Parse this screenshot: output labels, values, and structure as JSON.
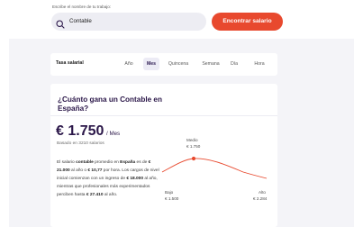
{
  "search": {
    "label": "Escribe el nombre de tu trabajo:",
    "value": "Contable",
    "button_label": "Encontrar salario"
  },
  "tabs": {
    "title": "Tasa salarial",
    "items": [
      {
        "label": "Año",
        "active": false
      },
      {
        "label": "Mes",
        "active": true
      },
      {
        "label": "Quincena",
        "active": false
      },
      {
        "label": "Semana",
        "active": false
      },
      {
        "label": "Día",
        "active": false
      },
      {
        "label": "Hora",
        "active": false
      }
    ]
  },
  "summary": {
    "question": "¿Cuánto gana un Contable en España?",
    "amount": "€ 1.750",
    "period": "/ Mes",
    "based_on": "Basado en 3210 salarios",
    "description": [
      {
        "text": "El salario ",
        "bold": false
      },
      {
        "text": "contable",
        "bold": true
      },
      {
        "text": " promedio en ",
        "bold": false
      },
      {
        "text": "España",
        "bold": true
      },
      {
        "text": " es de ",
        "bold": false
      },
      {
        "text": "€ 21.000",
        "bold": true
      },
      {
        "text": " al año o ",
        "bold": false
      },
      {
        "text": "€ 10,77",
        "bold": true
      },
      {
        "text": " por hora. Los cargos de nivel inicial comienzan con un ingreso de ",
        "bold": false
      },
      {
        "text": "€ 18.000",
        "bold": true
      },
      {
        "text": " al año, mientras que profesionales más experimentados perciben hasta ",
        "bold": false
      },
      {
        "text": "€ 27.410",
        "bold": true
      },
      {
        "text": " al año.",
        "bold": false
      }
    ]
  },
  "distribution": {
    "low_label": "Bajo",
    "low_value": "€ 1.500",
    "mid_label": "Medio",
    "mid_value": "€ 1.750",
    "high_label": "Alto",
    "high_value": "€ 2.284",
    "curve_color": "#e8492e"
  }
}
